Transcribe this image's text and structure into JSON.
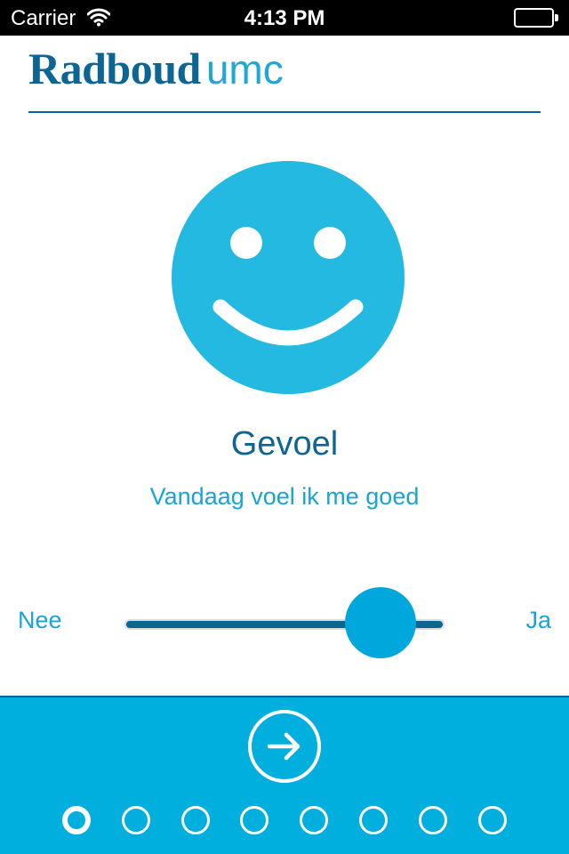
{
  "status_bar": {
    "carrier": "Carrier",
    "time": "4:13 PM",
    "icons": [
      "wifi-icon",
      "battery-icon"
    ]
  },
  "header": {
    "brand_primary": "Radboud",
    "brand_secondary": "umc"
  },
  "main": {
    "icon": "smiley-face-icon",
    "title": "Gevoel",
    "subtitle": "Vandaag voel ik me goed"
  },
  "slider": {
    "min_label": "Nee",
    "max_label": "Ja",
    "value_fraction": 0.8
  },
  "footer": {
    "next_icon": "arrow-right-icon",
    "page_count": 8,
    "current_page": 1
  },
  "colors": {
    "brand_dark": "#0c6592",
    "brand_light": "#20a6d8",
    "accent": "#00afde",
    "smiley": "#23b9e0"
  }
}
